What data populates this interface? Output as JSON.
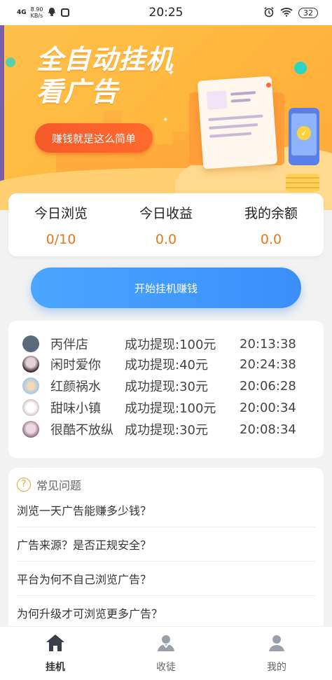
{
  "status_bar": {
    "network": "4G",
    "speed": "8.90",
    "speed_unit": "KB/s",
    "time": "20:25",
    "battery": "32"
  },
  "banner": {
    "title_line1": "全自动挂机",
    "title_line2": "看广告",
    "pill_text": "赚钱就是这么简单"
  },
  "stats": [
    {
      "label": "今日浏览",
      "value": "0/10"
    },
    {
      "label": "今日收益",
      "value": "0.0"
    },
    {
      "label": "我的余额",
      "value": "0.0"
    }
  ],
  "start_button": "开始挂机赚钱",
  "withdrawals": [
    {
      "name": "丙伴店",
      "amount": "成功提现:100元",
      "time": "20:13:38"
    },
    {
      "name": "闲时爱你",
      "amount": "成功提现:40元",
      "time": "20:24:38"
    },
    {
      "name": "红颜祸水",
      "amount": "成功提现:30元",
      "time": "20:06:28"
    },
    {
      "name": "甜味小镇",
      "amount": "成功提现:100元",
      "time": "20:00:34"
    },
    {
      "name": "很酷不放纵",
      "amount": "成功提现:30元",
      "time": "20:08:34"
    }
  ],
  "faq": {
    "title": "常见问题",
    "items": [
      "浏览一天广告能赚多少钱？",
      "广告来源？是否正规安全？",
      "平台为何不自己浏览广告？",
      "为何升级才可浏览更多广告？"
    ]
  },
  "nav": [
    {
      "label": "挂机",
      "icon": "home-icon",
      "active": true
    },
    {
      "label": "收徒",
      "icon": "apprentice-icon",
      "active": false
    },
    {
      "label": "我的",
      "icon": "profile-icon",
      "active": false
    }
  ],
  "colors": {
    "accent_orange": "#e07a20",
    "button_blue": "#3b8ef8",
    "banner_yellow": "#ffb83e"
  }
}
